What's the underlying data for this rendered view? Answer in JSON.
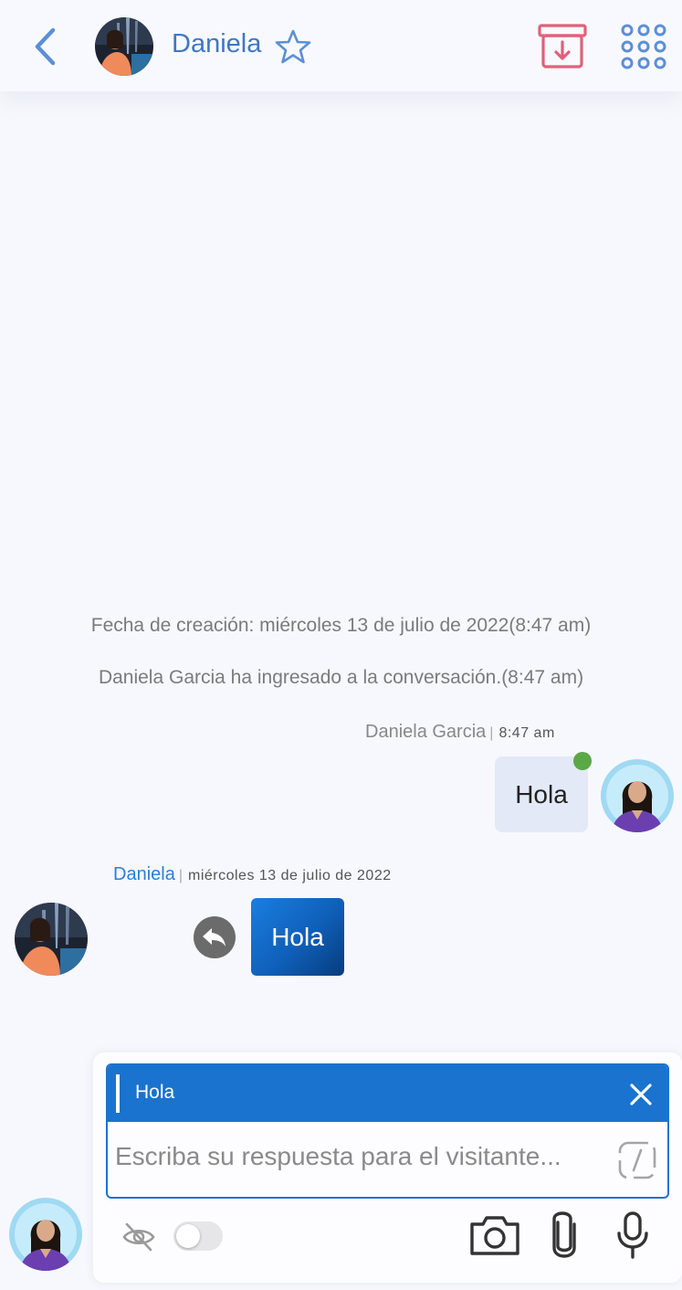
{
  "header": {
    "contact_name": "Daniela",
    "accent_color": "#3f76c4",
    "archive_color": "#e0607a"
  },
  "conversation": {
    "creation_notice": "Fecha de creación: miércoles 13 de julio de 2022(8:47 am)",
    "joined_notice": "Daniela Garcia ha ingresado a la conversación.(8:47 am)",
    "outgoing": {
      "sender": "Daniela Garcia",
      "separator": "|",
      "time": "8:47 am",
      "text": "Hola",
      "status_color": "#5aa846"
    },
    "incoming": {
      "sender": "Daniela",
      "separator": "|",
      "date": "miércoles 13 de julio de 2022",
      "text": "Hola"
    }
  },
  "composer": {
    "reply_preview": "Hola",
    "placeholder": "Escriba su respuesta para el visitante...",
    "value": "",
    "private_toggle_on": false
  },
  "icons": {
    "back": "chevron-left-icon",
    "favorite": "star-outline-icon",
    "archive": "archive-download-icon",
    "apps": "grid-dots-icon",
    "reply": "reply-arrow-icon",
    "close": "close-icon",
    "shortcut": "slash-command-icon",
    "visibility": "eye-off-icon",
    "camera": "camera-icon",
    "attach": "paperclip-icon",
    "mic": "microphone-icon"
  }
}
